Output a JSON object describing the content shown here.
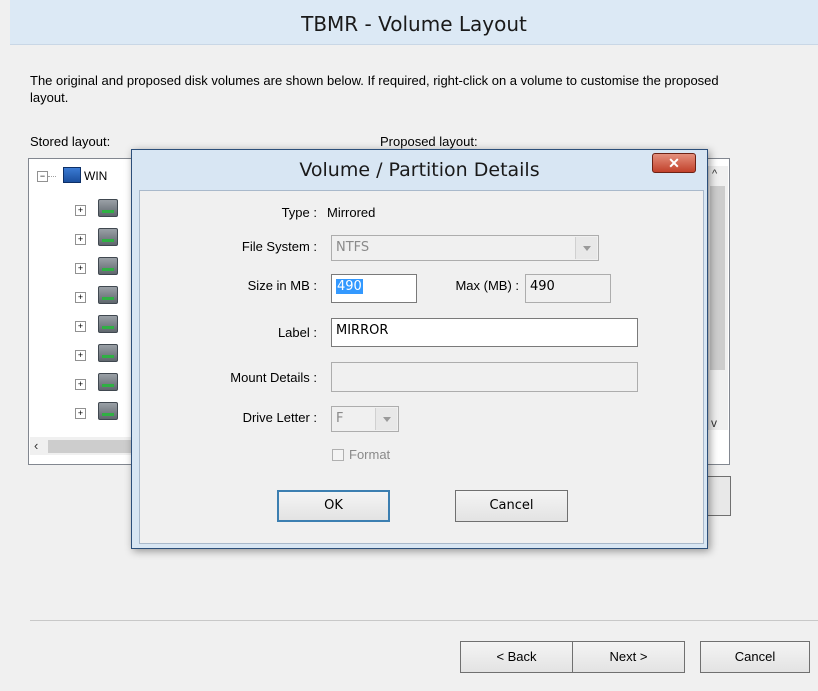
{
  "wizard": {
    "title": "TBMR - Volume Layout",
    "description": "The original and proposed disk volumes are shown below. If required, right-click on a volume to customise the proposed layout.",
    "stored_label": "Stored layout:",
    "proposed_label": "Proposed layout:",
    "tree_root": "WIN",
    "back_label": "< Back",
    "next_label": "Next >",
    "cancel_label": "Cancel"
  },
  "dialog": {
    "title": "Volume / Partition Details",
    "close_glyph": "✕",
    "type_label": "Type :",
    "type_value": "Mirrored",
    "filesystem_label": "File System :",
    "filesystem_value": "NTFS",
    "size_label": "Size in MB :",
    "size_value": "490",
    "max_label": "Max (MB) :",
    "max_value": "490",
    "volume_label_label": "Label :",
    "volume_label_value": "MIRROR",
    "mount_label": "Mount Details :",
    "mount_value": "",
    "drive_letter_label": "Drive Letter :",
    "drive_letter_value": "F",
    "format_label": "Format",
    "ok_label": "OK",
    "cancel_label": "Cancel"
  },
  "icons": [
    "computer-icon",
    "disk-icon",
    "expand-icon",
    "close-icon",
    "chevron-down-icon",
    "chevron-up-icon",
    "chevron-left-icon"
  ]
}
